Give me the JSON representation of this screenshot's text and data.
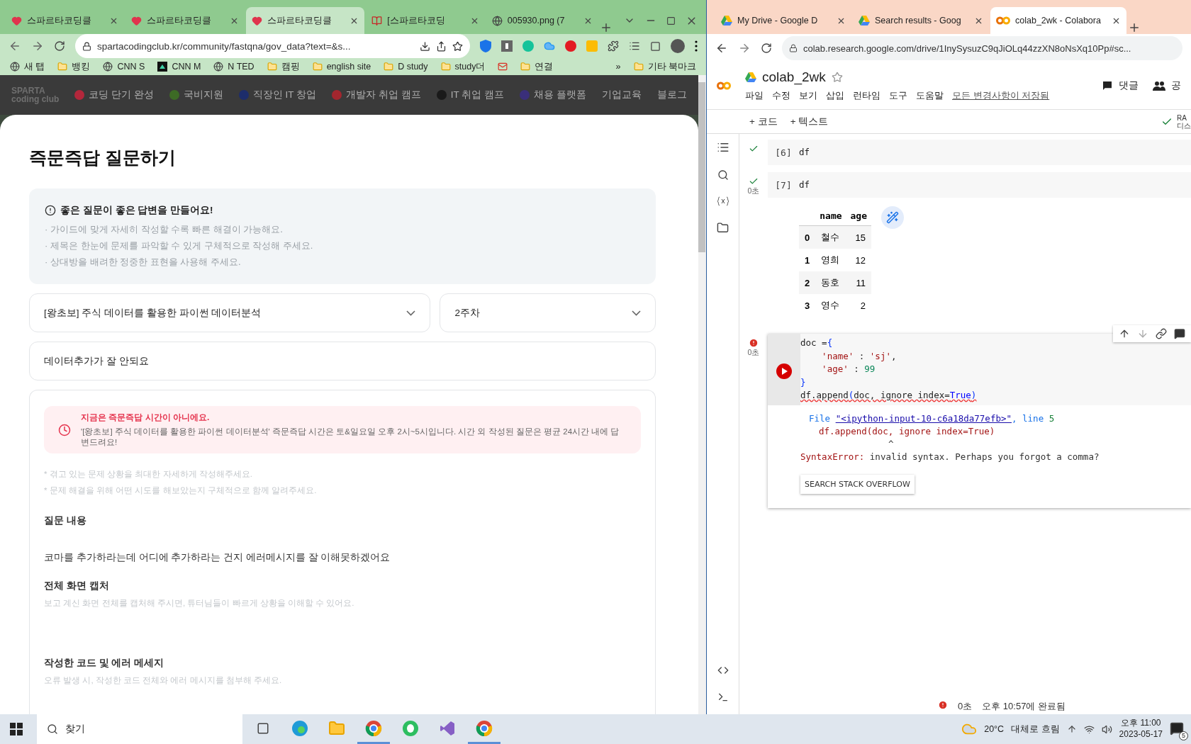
{
  "left_browser": {
    "tabs": [
      {
        "title": "스파르타코딩클",
        "kind": "heart",
        "selected": false
      },
      {
        "title": "스파르타코딩클",
        "kind": "heart",
        "selected": false
      },
      {
        "title": "스파르타코딩클",
        "kind": "heart",
        "selected": true
      },
      {
        "title": "[스파르타코딩",
        "kind": "book",
        "selected": false
      },
      {
        "title": "005930.png (7",
        "kind": "globe",
        "selected": false
      }
    ],
    "url": "spartacodingclub.kr/community/fastqna/gov_data?text=&s...",
    "bookmarks": [
      {
        "label": "새 탭",
        "kind": "globe"
      },
      {
        "label": "뱅킹",
        "kind": "folder"
      },
      {
        "label": "CNN S",
        "kind": "globe"
      },
      {
        "label": "CNN M",
        "kind": "square"
      },
      {
        "label": "N TED",
        "kind": "globe"
      },
      {
        "label": "캠핑",
        "kind": "folder"
      },
      {
        "label": "english site",
        "kind": "folder"
      },
      {
        "label": "D study",
        "kind": "folder"
      },
      {
        "label": "study더",
        "kind": "folder"
      },
      {
        "kind": "mail"
      },
      {
        "label": "연결",
        "kind": "folder"
      }
    ],
    "bookmarks_overflow": "»",
    "other_bookmarks": "기타 북마크",
    "site_nav": {
      "logo_word": "SPARTA",
      "logo_sub": "coding club",
      "items": [
        {
          "label": "코딩 단기 완성",
          "color": "#b3273b"
        },
        {
          "label": "국비지원",
          "color": "#3d6b25"
        },
        {
          "label": "직장인 IT 창업",
          "color": "#1d2d6b"
        },
        {
          "label": "개발자 취업 캠프",
          "color": "#a3262e"
        },
        {
          "label": "IT 취업 캠프",
          "color": "#1a1a1a"
        },
        {
          "label": "채용 플랫폼",
          "color": "#3a2f7a"
        },
        {
          "label": "기업교육"
        },
        {
          "label": "블로그"
        }
      ]
    },
    "modal": {
      "title": "즉문즉답 질문하기",
      "guide": {
        "heading": "좋은 질문이 좋은 답변을 만들어요!",
        "bullets": [
          "· 가이드에 맞게 자세히 작성할 수록 빠른 해결이 가능해요.",
          "· 제목은 한눈에 문제를 파악할 수 있게 구체적으로 작성해 주세요.",
          "· 상대방을 배려한 정중한 표현을 사용해 주세요."
        ]
      },
      "course_select": "[왕초보] 주식 데이터를 활용한 파이썬 데이터분석",
      "week_select": "2주차",
      "title_field": "데이터추가가 잘 안되요",
      "notice": {
        "heading": "지금은 즉문즉답 시간이 아니에요.",
        "body": "'[왕초보] 주식 데이터를 활용한 파이썬 데이터분석' 즉문즉답 시간은 토&일요일 오후 2시~5시입니다. 시간 외 작성된 질문은 평균 24시간 내에 답변드려요!"
      },
      "hints": [
        "* 겪고 있는 문제 상황을 최대한 자세하게 작성해주세요.",
        "* 문제 해결을 위해 어떤 시도를 해보았는지 구체적으로 함께 알려주세요."
      ],
      "sections": [
        {
          "heading": "질문 내용",
          "body": "코마를 추가하라는데 어디에 추가하라는 건지 에러메시지를 잘 이해못하겠어요"
        },
        {
          "heading": "전체 화면 캡처",
          "hint": "보고 계신 화면 전체를 캡처해 주시면, 튜터님들이 빠르게 상황을 이해할 수 있어요."
        },
        {
          "heading": "작성한 코드 및 에러 메세지",
          "hint": "오류 발생 시, 작성한 코드 전체와 에러 메시지를 첨부해 주세요."
        }
      ]
    }
  },
  "right_browser": {
    "tabs": [
      {
        "title": "My Drive - Google D",
        "kind": "drive",
        "selected": false
      },
      {
        "title": "Search results - Goog",
        "kind": "drive",
        "selected": false
      },
      {
        "title": "colab_2wk - Colabora",
        "kind": "colab",
        "selected": true
      }
    ],
    "url": "colab.research.google.com/drive/1InySysuzC9qJiOLq44zzXN8oNsXq10Pp#sc...",
    "notebook": {
      "title": "colab_2wk",
      "menus": [
        "파일",
        "수정",
        "보기",
        "삽입",
        "런타임",
        "도구",
        "도움말"
      ],
      "save_status": "모든 변경사항이 저장됨",
      "comments": "댓글",
      "share": "공",
      "add_code": "+ 코드",
      "add_text": "+ 텍스트",
      "ram": "RA",
      "disk": "디스",
      "cells": [
        {
          "kind": "code",
          "number": "[6]",
          "failed": false,
          "lines": [
            [
              {
                "t": "df",
                "kind": "plain"
              }
            ]
          ]
        },
        {
          "kind": "table",
          "number": "[7]",
          "failed": false,
          "time": "0초",
          "lines": [
            [
              {
                "t": "df",
                "kind": "plain"
              }
            ]
          ],
          "columns": [
            "",
            "name",
            "age"
          ],
          "rows": [
            [
              "0",
              "철수",
              "15"
            ],
            [
              "1",
              "영희",
              "12"
            ],
            [
              "2",
              "동호",
              "11"
            ],
            [
              "3",
              "영수",
              "2"
            ]
          ]
        },
        {
          "kind": "error",
          "failed": true,
          "time": "0초",
          "lines": [
            [
              {
                "t": "doc =",
                "kind": "plain"
              },
              {
                "t": "{",
                "kind": "bracket"
              }
            ],
            [
              {
                "t": "    'name'",
                "kind": "string"
              },
              {
                "t": " : ",
                "kind": "plain"
              },
              {
                "t": "'sj'",
                "kind": "string"
              },
              {
                "t": ",",
                "kind": "plain"
              }
            ],
            [
              {
                "t": "    'age'",
                "kind": "string"
              },
              {
                "t": " : ",
                "kind": "plain"
              },
              {
                "t": "99",
                "kind": "number"
              }
            ],
            [
              {
                "t": "}",
                "kind": "bracket"
              }
            ],
            [
              {
                "t": "df.append",
                "kind": "plain"
              },
              {
                "t": "(",
                "kind": "bracket"
              },
              {
                "t": "doc, ignore index=",
                "kind": "plain"
              },
              {
                "t": "True",
                "kind": "keyword"
              },
              {
                "t": ")",
                "kind": "bracket"
              }
            ]
          ],
          "traceback": {
            "file_prefix": "File ",
            "file_link": "\"<ipython-input-10-c6a18da77efb>\"",
            "file_suffix": ", line ",
            "line_no": "5",
            "code": "df.append(doc, ignore index=True)",
            "caret": "^",
            "error_name": "SyntaxError:",
            "error_msg": " invalid syntax. Perhaps you forgot a comma?"
          },
          "button": "SEARCH STACK OVERFLOW"
        }
      ]
    },
    "status_time": "0초",
    "status_text": "오후 10:57에 완료됨"
  },
  "taskbar": {
    "search": "찾기",
    "apps": [
      {
        "kind": "taskview",
        "selected": false
      },
      {
        "kind": "edge",
        "selected": false
      },
      {
        "kind": "explorer",
        "selected": false
      },
      {
        "kind": "chrome",
        "selected": true
      },
      {
        "kind": "evernote",
        "selected": false
      },
      {
        "kind": "vs",
        "selected": false
      },
      {
        "kind": "chrome",
        "selected": true
      }
    ],
    "temperature": "20°C",
    "weather": "대체로 흐림",
    "time": "오후 11:00",
    "date": "2023-05-17",
    "notifications": "5"
  }
}
